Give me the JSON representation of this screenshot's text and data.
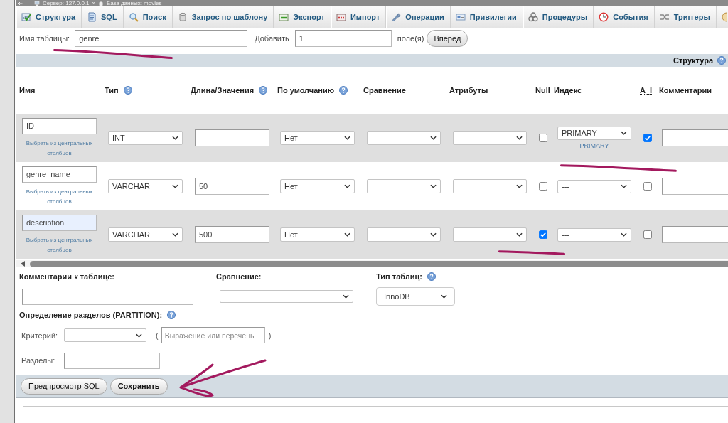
{
  "breadcrumb": {
    "items": [
      {
        "label": "Сервер: 127.0.0.1"
      },
      {
        "label": "База данных: movies"
      }
    ],
    "separator": "»"
  },
  "tabs": [
    {
      "label": "Структура",
      "selected": false
    },
    {
      "label": "SQL",
      "selected": false
    },
    {
      "label": "Поиск",
      "selected": false
    },
    {
      "label": "Запрос по шаблону",
      "selected": false
    },
    {
      "label": "Экспорт",
      "selected": false
    },
    {
      "label": "Импорт",
      "selected": false
    },
    {
      "label": "Операции",
      "selected": false
    },
    {
      "label": "Привилегии",
      "selected": false
    },
    {
      "label": "Процедуры",
      "selected": false
    },
    {
      "label": "События",
      "selected": false
    },
    {
      "label": "Триггеры",
      "selected": false
    }
  ],
  "table_name": {
    "label": "Имя таблицы:",
    "value": "genre",
    "underlined": true
  },
  "add_fields": {
    "label": "Добавить",
    "value": "1",
    "unit": "поле(я)",
    "button": "Вперёд"
  },
  "section_header": {
    "title": "Структура",
    "help": true
  },
  "table": {
    "columns": [
      {
        "label": "Имя",
        "help": false,
        "abbreviation": false
      },
      {
        "label": "Тип",
        "help": true,
        "abbreviation": false
      },
      {
        "label": "Длина/Значения",
        "help": true,
        "abbreviation": false
      },
      {
        "label": "По умолчанию",
        "help": true,
        "abbreviation": false
      },
      {
        "label": "Сравнение",
        "help": false,
        "abbreviation": false
      },
      {
        "label": "Атрибуты",
        "help": false,
        "abbreviation": false
      },
      {
        "label": "Null",
        "help": false,
        "abbreviation": false
      },
      {
        "label": "Индекс",
        "help": false,
        "abbreviation": false
      },
      {
        "label": "A_I",
        "help": false,
        "abbreviation": true
      },
      {
        "label": "Комментарии",
        "help": false,
        "abbreviation": false
      }
    ],
    "rows": [
      {
        "name": "ID",
        "name_autofilled": false,
        "central_link": "Выбрать из центральных столбцов",
        "type": "INT",
        "default": "Нет",
        "null": false,
        "null_underlined": false,
        "index": "PRIMARY",
        "index_label": "PRIMARY",
        "index_underlined": true,
        "auto_increment": true
      },
      {
        "name": "genre_name",
        "name_autofilled": false,
        "central_link": "Выбрать из центральных столбцов",
        "type": "VARCHAR",
        "length": "50",
        "default": "Нет",
        "null": false,
        "null_underlined": false,
        "index": "---",
        "index_underlined": false,
        "auto_increment": false
      },
      {
        "name": "description",
        "name_autofilled": true,
        "central_link": "Выбрать из центральных столбцов",
        "type": "VARCHAR",
        "length": "500",
        "default": "Нет",
        "null": true,
        "null_underlined": true,
        "index": "---",
        "index_underlined": false,
        "auto_increment": false
      }
    ]
  },
  "options": {
    "comment_label": "Комментарии к таблице:",
    "collation_label": "Сравнение:",
    "engine_label": "Тип таблиц:",
    "engine_help": true,
    "engine": "InnoDB"
  },
  "partition": {
    "title": "Определение разделов (PARTITION):",
    "help": true,
    "criterion_label": "Критерий:",
    "open_paren": "(",
    "expression_placeholder": "Выражение или перечень",
    "close_paren": ")",
    "partitions_label": "Разделы:"
  },
  "buttons": [
    {
      "label": "Предпросмотр SQL",
      "primary": false,
      "arrow_pointed": false
    },
    {
      "label": "Сохранить",
      "primary": true,
      "arrow_pointed": true
    }
  ]
}
